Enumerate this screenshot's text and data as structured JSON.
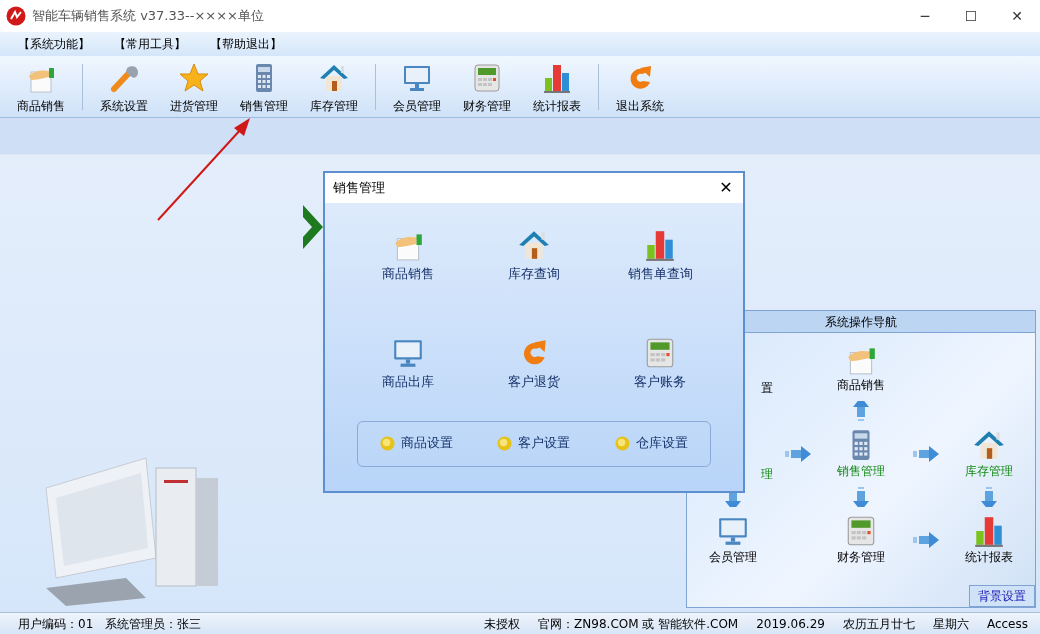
{
  "window": {
    "title": "智能车辆销售系统 v37.33--××××单位",
    "controls": [
      "─",
      "☐",
      "✕"
    ]
  },
  "menu": [
    {
      "label": "【系统功能】"
    },
    {
      "label": "【常用工具】"
    },
    {
      "label": "【帮助退出】"
    }
  ],
  "toolbar": [
    {
      "items": [
        {
          "label": "商品销售",
          "kind": "hand"
        }
      ]
    },
    {
      "items": [
        {
          "label": "系统设置",
          "kind": "wrench"
        },
        {
          "label": "进货管理",
          "kind": "star"
        },
        {
          "label": "销售管理",
          "kind": "calculator"
        },
        {
          "label": "库存管理",
          "kind": "house"
        }
      ]
    },
    {
      "items": [
        {
          "label": "会员管理",
          "kind": "monitor"
        },
        {
          "label": "财务管理",
          "kind": "register"
        },
        {
          "label": "统计报表",
          "kind": "chart"
        }
      ]
    },
    {
      "items": [
        {
          "label": "退出系统",
          "kind": "refresh"
        }
      ]
    }
  ],
  "dialog": {
    "title": "销售管理",
    "close": "✕",
    "items": [
      {
        "label": "商品销售",
        "kind": "hand"
      },
      {
        "label": "库存查询",
        "kind": "house"
      },
      {
        "label": "销售单查询",
        "kind": "chart"
      },
      {
        "label": "商品出库",
        "kind": "monitor"
      },
      {
        "label": "客户退货",
        "kind": "refresh"
      },
      {
        "label": "客户账务",
        "kind": "register"
      }
    ],
    "settings": [
      {
        "label": "商品设置"
      },
      {
        "label": "客户设置"
      },
      {
        "label": "仓库设置"
      }
    ]
  },
  "navigation": {
    "title": "系统操作导航",
    "cells": [
      {
        "kind": "partial",
        "label": "置",
        "highlight": false
      },
      {
        "kind": "blank"
      },
      {
        "kind": "hand",
        "label": "商品销售",
        "highlight": false
      },
      {
        "kind": "blank"
      },
      {
        "kind": "blank"
      },
      {
        "kind": "blank"
      },
      {
        "kind": "blank"
      },
      {
        "kind": "arrowup"
      },
      {
        "kind": "blank"
      },
      {
        "kind": "blank"
      },
      {
        "kind": "partial",
        "label": "理",
        "highlight": true
      },
      {
        "kind": "arrowright"
      },
      {
        "kind": "calculator",
        "label": "销售管理",
        "highlight": true
      },
      {
        "kind": "arrowright"
      },
      {
        "kind": "house",
        "label": "库存管理",
        "highlight": true
      },
      {
        "kind": "arrowdown"
      },
      {
        "kind": "blank"
      },
      {
        "kind": "arrowdown"
      },
      {
        "kind": "blank"
      },
      {
        "kind": "arrowdown"
      },
      {
        "kind": "monitor",
        "label": "会员管理",
        "highlight": false
      },
      {
        "kind": "blank"
      },
      {
        "kind": "register",
        "label": "财务管理",
        "highlight": false
      },
      {
        "kind": "arrowright"
      },
      {
        "kind": "chart",
        "label": "统计报表",
        "highlight": false
      }
    ],
    "background_button": "背景设置"
  },
  "status_bar": [
    "用户编码：01",
    "系统管理员：张三",
    "未授权",
    "官网：ZN98.COM 或 智能软件.COM",
    "2019.06.29",
    "农历五月廿七",
    "星期六",
    "Access"
  ]
}
